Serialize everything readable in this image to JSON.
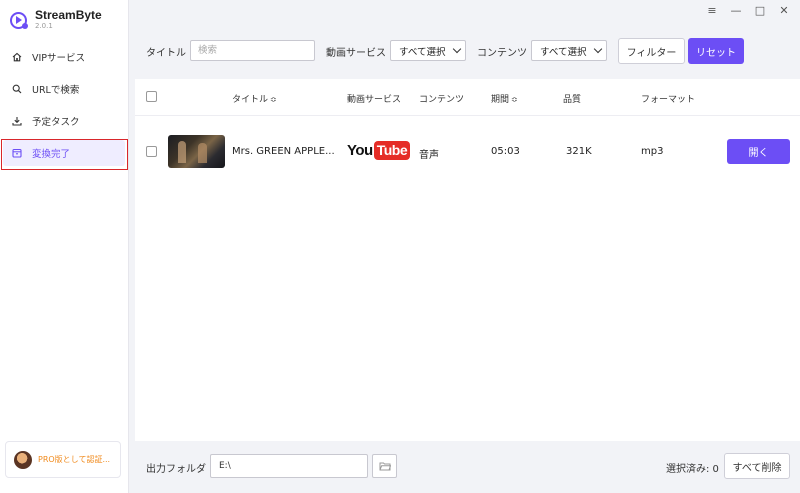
{
  "app": {
    "name": "StreamByte",
    "version": "2.0.1"
  },
  "window_controls": {
    "menu": "≡",
    "minimize": "—",
    "maximize": "□",
    "close": "✕"
  },
  "sidebar": {
    "items": [
      {
        "label": "VIPサービス",
        "icon": "home-icon"
      },
      {
        "label": "URLで検索",
        "icon": "search-icon"
      },
      {
        "label": "予定タスク",
        "icon": "download-icon"
      },
      {
        "label": "変換完了",
        "icon": "box-icon",
        "active": true
      }
    ],
    "pro_text": "PRO版として認証..."
  },
  "filters": {
    "title_label": "タイトル",
    "search_placeholder": "検索",
    "service_label": "動画サービス",
    "service_value": "すべて選択",
    "content_label": "コンテンツ",
    "content_value": "すべて選択",
    "filter_button": "フィルター",
    "reset_button": "リセット"
  },
  "table": {
    "headers": [
      "タイトル",
      "動画サービス",
      "コンテンツ",
      "期間",
      "品質",
      "フォーマット"
    ],
    "sort_glyph": "≎",
    "rows": [
      {
        "title": "Mrs. GREEN APPLE...",
        "service": {
          "you": "You",
          "tube": "Tube"
        },
        "content": "音声",
        "duration": "05:03",
        "quality": "321K",
        "format": "mp3",
        "action": "開く"
      }
    ]
  },
  "bottom": {
    "output_label": "出力フォルダ",
    "output_path": "E:\\",
    "selected_text": "選択済み: 0",
    "delete_all": "すべて削除"
  },
  "colors": {
    "accent": "#6c4ef5",
    "highlight": "#d9262b",
    "pro": "#f08a1c",
    "youtube": "#e52d27"
  }
}
